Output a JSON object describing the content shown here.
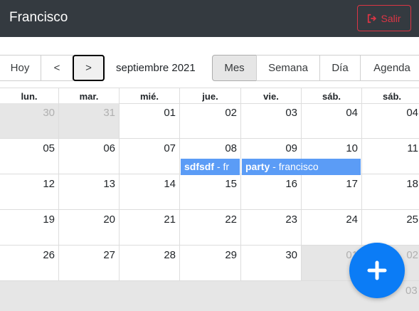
{
  "navbar": {
    "brand": "Francisco",
    "logout_label": "Salir",
    "logout_color": "#dc3545"
  },
  "toolbar": {
    "today": "Hoy",
    "prev": "<",
    "next": ">",
    "label": "septiembre 2021",
    "views": [
      "Mes",
      "Semana",
      "Día",
      "Agenda"
    ],
    "active_view": "Mes"
  },
  "calendar": {
    "headers": [
      "lun.",
      "mar.",
      "mié.",
      "jue.",
      "vie.",
      "sáb.",
      "sáb."
    ],
    "weeks": [
      [
        "30",
        "31",
        "01",
        "02",
        "03",
        "04",
        "04"
      ],
      [
        "05",
        "06",
        "07",
        "08",
        "09",
        "10",
        "11"
      ],
      [
        "12",
        "13",
        "14",
        "15",
        "16",
        "17",
        "18"
      ],
      [
        "19",
        "20",
        "21",
        "22",
        "23",
        "24",
        "25"
      ],
      [
        "26",
        "27",
        "28",
        "29",
        "30",
        "01",
        "02"
      ]
    ],
    "extra_day": "03",
    "events": [
      {
        "title": "sdfsdf",
        "sep": " - ",
        "owner": "fr"
      },
      {
        "title": "party",
        "sep": " - ",
        "owner": "francisco"
      }
    ],
    "event_color": "#5b9cf6"
  },
  "fab": {
    "icon": "plus-icon",
    "color": "#0b7cf6"
  }
}
